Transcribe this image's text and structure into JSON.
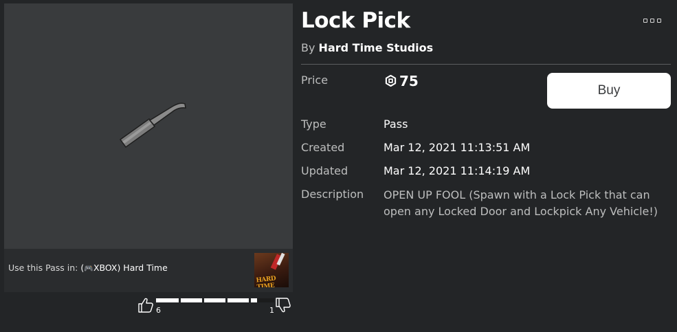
{
  "item": {
    "title": "Lock Pick",
    "by_prefix": "By",
    "creator": "Hard Time Studios"
  },
  "details": {
    "price_label": "Price",
    "price_value": "75",
    "type_label": "Type",
    "type_value": "Pass",
    "created_label": "Created",
    "created_value": "Mar 12, 2021 11:13:51 AM",
    "updated_label": "Updated",
    "updated_value": "Mar 12, 2021 11:14:19 AM",
    "description_label": "Description",
    "description_value": "OPEN UP FOOL (Spawn with a Lock Pick that can open any Locked Door and Lockpick Any Vehicle!)"
  },
  "buy": {
    "label": "Buy"
  },
  "use_in": {
    "prefix": "Use this Pass in:",
    "game_open": "(",
    "game_name": "XBOX) Hard Time",
    "thumb_text": "HARD TIME"
  },
  "votes": {
    "up": "6",
    "down": "1",
    "up_fraction": 0.857
  },
  "icons": {
    "more": "more-options-icon",
    "robux": "robux-icon",
    "thumb_up": "thumbs-up-icon",
    "thumb_down": "thumbs-down-icon",
    "controller": "game-controller-icon"
  },
  "colors": {
    "background": "#232527",
    "panel": "#393b3d",
    "buy_button": "#ffffff",
    "muted_text": "#bdbebe"
  }
}
